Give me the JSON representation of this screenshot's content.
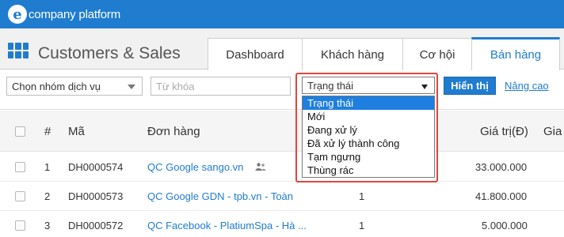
{
  "brand": {
    "logo_letter": "e",
    "logo_text": "company platform"
  },
  "header": {
    "title": "Customers & Sales",
    "tabs": [
      {
        "label": "Dashboard"
      },
      {
        "label": "Khách hàng"
      },
      {
        "label": "Cơ hội"
      },
      {
        "label": "Bán hàng",
        "active": true
      }
    ]
  },
  "filters": {
    "service_group": "Chọn nhóm dịch vụ",
    "keyword_placeholder": "Từ khóa",
    "status_selected": "Trạng thái",
    "status_options": [
      "Trạng thái",
      "Mới",
      "Đang xử lý",
      "Đã xử lý thành công",
      "Tạm ngưng",
      "Thùng rác"
    ],
    "show_button": "Hiển thị",
    "advanced_link": "Nâng cao"
  },
  "table": {
    "columns": {
      "index": "#",
      "code": "Mã",
      "order": "Đơn hàng",
      "value": "Giá trị(Đ)",
      "extra": "Gia"
    },
    "rows": [
      {
        "index": "1",
        "code": "DH0000574",
        "order": "QC Google sango.vn",
        "qty": "",
        "value": "33.000.000"
      },
      {
        "index": "2",
        "code": "DH0000573",
        "order": "QC Google GDN - tpb.vn - Toàn",
        "qty": "1",
        "value": "41.800.000"
      },
      {
        "index": "3",
        "code": "DH0000572",
        "order": "QC Facebook - PlatiumSpa - Hà ...",
        "qty": "1",
        "value": "5.000.000"
      }
    ]
  },
  "colors": {
    "brand_blue": "#1f7ccf",
    "highlight_red": "#e0463f",
    "selected_blue": "#1e7fe0"
  }
}
